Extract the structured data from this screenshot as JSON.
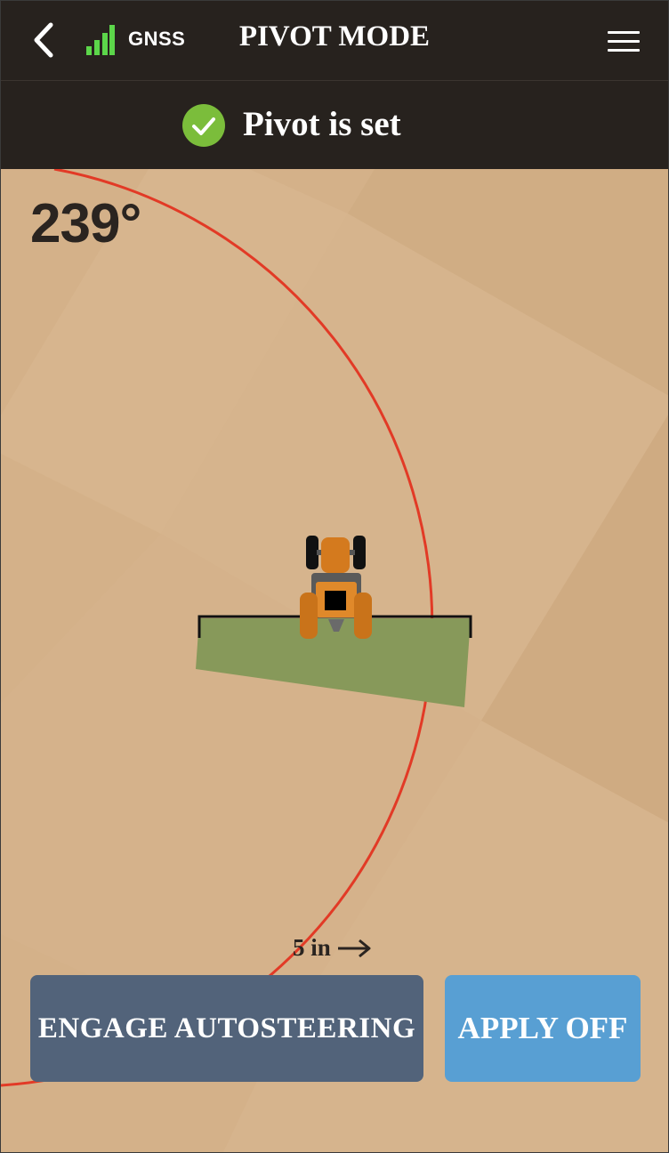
{
  "header": {
    "back_icon": "chevron-left-icon",
    "signal_icon": "signal-bars-icon",
    "signal_label": "GNSS",
    "title": "PIVOT MODE",
    "menu_icon": "hamburger-menu-icon"
  },
  "status": {
    "icon": "check-circle-icon",
    "text": "Pivot is set"
  },
  "map": {
    "heading_value": "239°",
    "scale_label": "5 in",
    "scale_icon": "arrow-right-icon",
    "tractor_icon": "tractor-icon",
    "pivot_circle_color": "#e23a26",
    "coverage_color": "#87995a"
  },
  "actions": {
    "engage_label": "ENGAGE AUTOSTEERING",
    "apply_label": "APPLY OFF"
  },
  "colors": {
    "topbar_bg": "#27221e",
    "field_bg": "#d4b189",
    "engage_bg": "#52637a",
    "apply_bg": "#589fd3",
    "gnss_green": "#5cd64a",
    "check_green": "#7bbd3b"
  }
}
